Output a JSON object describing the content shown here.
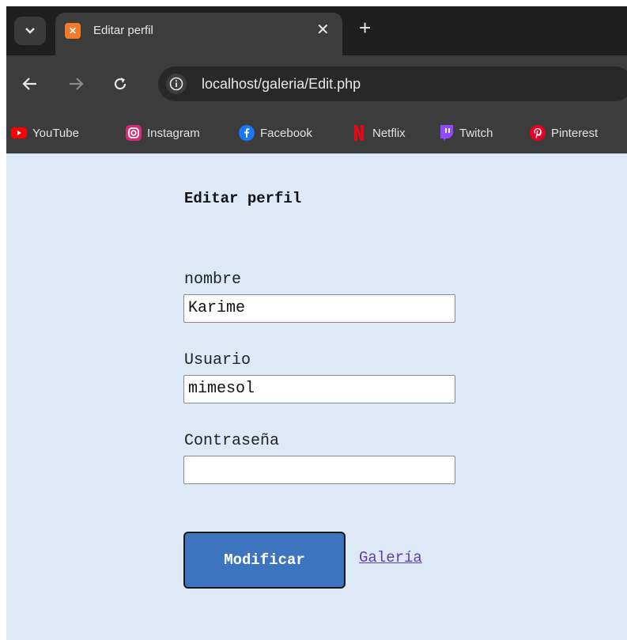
{
  "browser": {
    "tab": {
      "title": "Editar perfil",
      "close": "✕"
    },
    "new_tab": "+",
    "url": "localhost/galeria/Edit.php",
    "bookmarks": [
      {
        "label": "YouTube"
      },
      {
        "label": "Instagram"
      },
      {
        "label": "Facebook"
      },
      {
        "label": "Netflix"
      },
      {
        "label": "Twitch"
      },
      {
        "label": "Pinterest"
      }
    ]
  },
  "form": {
    "heading": "Editar perfil",
    "fields": [
      {
        "label": "nombre",
        "value": "Karime"
      },
      {
        "label": "Usuario",
        "value": "mimesol"
      },
      {
        "label": "Contraseña",
        "value": ""
      }
    ],
    "submit_label": "Modificar",
    "gallery_link": "Galería"
  },
  "colors": {
    "page_background": "#dde9f7",
    "button": "#3c74c0",
    "link": "#5f3ea7"
  }
}
